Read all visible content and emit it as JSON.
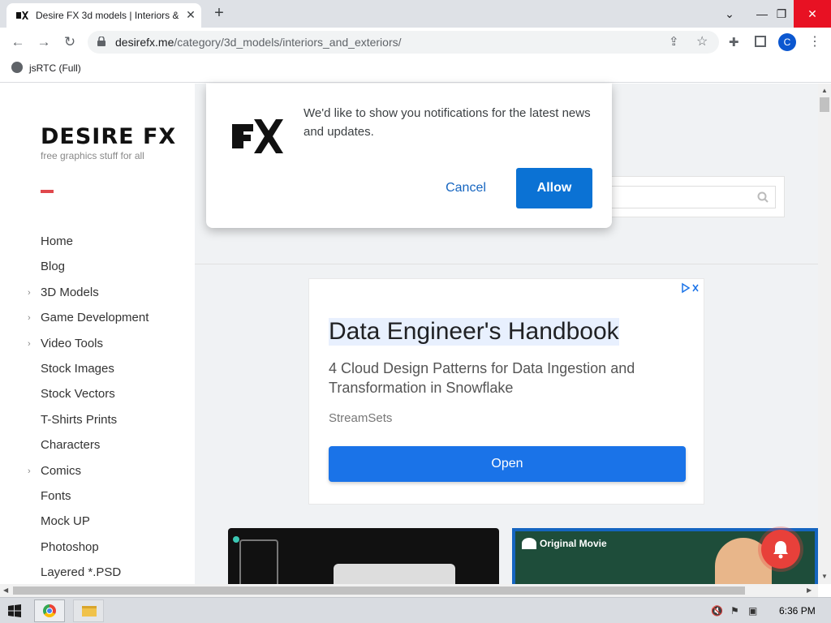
{
  "browser": {
    "tab_title": "Desire FX 3d models | Interiors &",
    "url_domain": "desirefx.me",
    "url_path": "/category/3d_models/interiors_and_exteriors/",
    "bookmark": "jsRTC (Full)",
    "profile_initial": "C"
  },
  "sidebar": {
    "logo": "DESIRE FX",
    "tagline": "free graphics stuff for all",
    "items": [
      {
        "label": "Home",
        "has_children": false
      },
      {
        "label": "Blog",
        "has_children": false
      },
      {
        "label": "3D Models",
        "has_children": true
      },
      {
        "label": "Game Development",
        "has_children": true
      },
      {
        "label": "Video Tools",
        "has_children": true
      },
      {
        "label": "Stock Images",
        "has_children": false
      },
      {
        "label": "Stock Vectors",
        "has_children": false
      },
      {
        "label": "T-Shirts Prints",
        "has_children": false
      },
      {
        "label": "Characters",
        "has_children": false
      },
      {
        "label": "Comics",
        "has_children": true
      },
      {
        "label": "Fonts",
        "has_children": false
      },
      {
        "label": "Mock UP",
        "has_children": false
      },
      {
        "label": "Photoshop",
        "has_children": false
      },
      {
        "label": "Layered *.PSD",
        "has_children": false
      }
    ]
  },
  "notification_prompt": {
    "text": "We'd like to show you notifications for the latest news and updates.",
    "cancel_label": "Cancel",
    "allow_label": "Allow"
  },
  "ad": {
    "title": "Data Engineer's Handbook",
    "description": "4 Cloud Design Patterns for Data Ingestion and Transformation in Snowflake",
    "brand": "StreamSets",
    "cta": "Open"
  },
  "thumbnails": {
    "second_badge": "Original Movie"
  },
  "taskbar": {
    "time": "6:36 PM"
  },
  "colors": {
    "accent_red": "#e0474c",
    "ad_button": "#1a73e8",
    "allow_button": "#0b72d4"
  }
}
